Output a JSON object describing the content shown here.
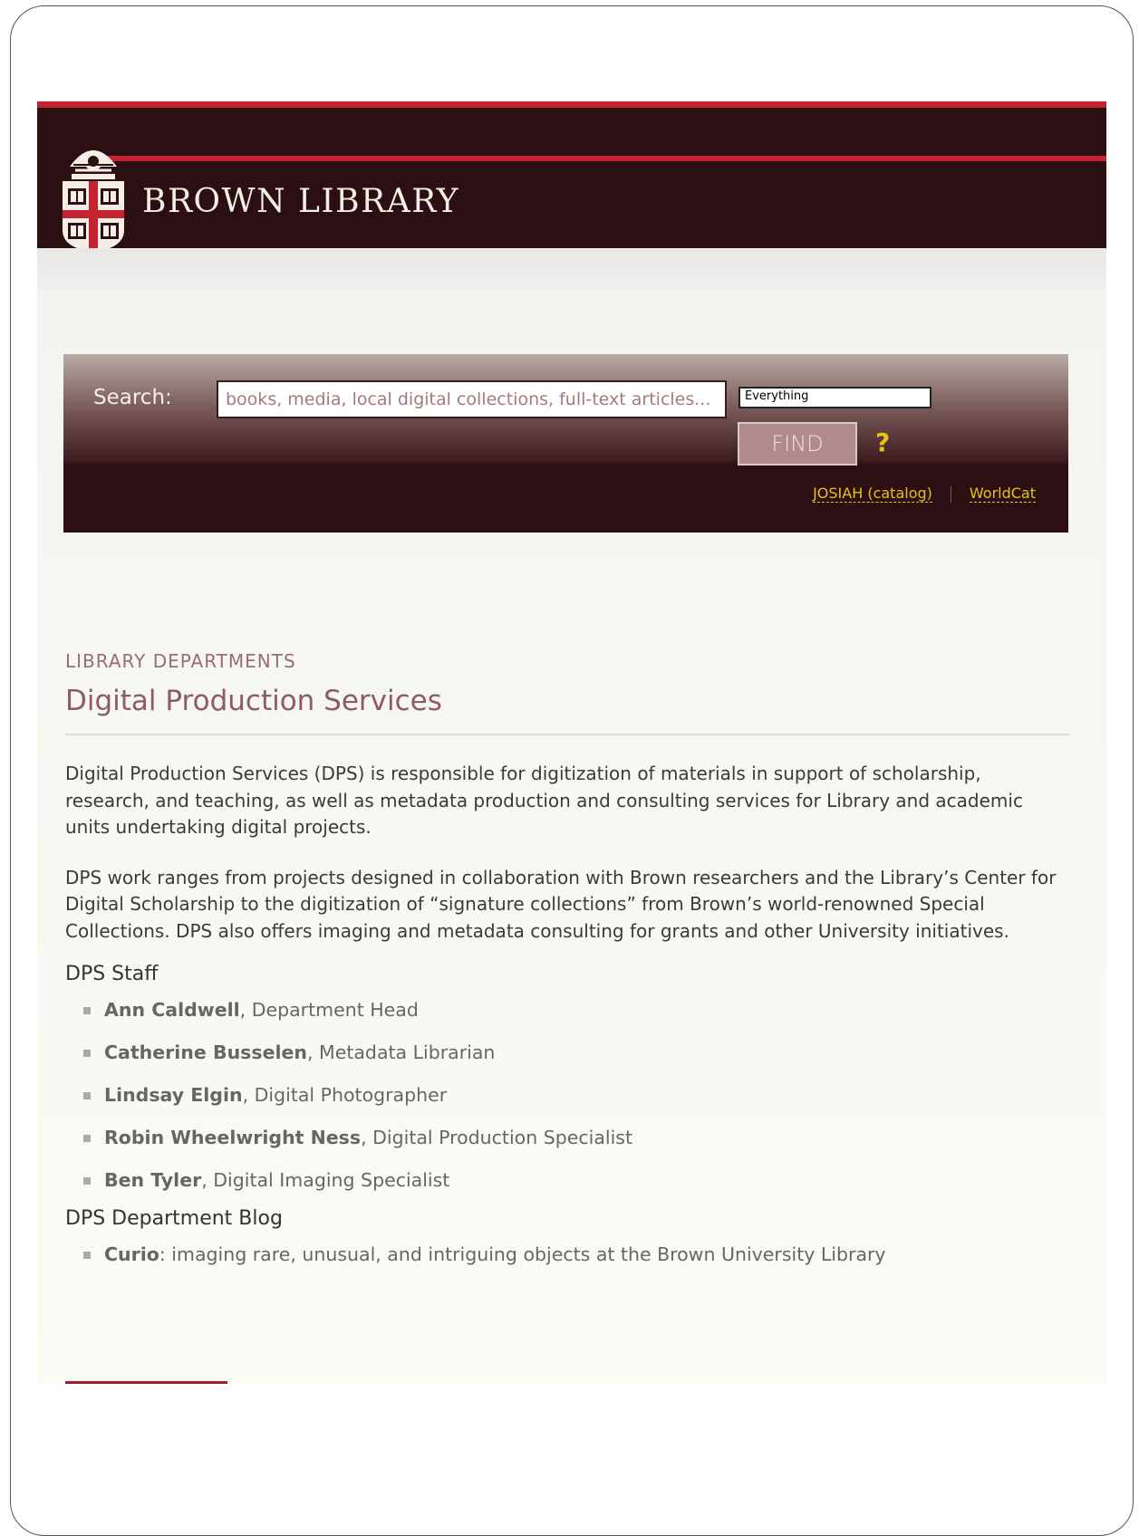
{
  "brand": {
    "name": "BROWN LIBRARY"
  },
  "search": {
    "label": "Search:",
    "placeholder": "books, media, local digital collections, full-text articles...",
    "scope_selected": "Everything",
    "find_label": "FIND",
    "help_label": "?"
  },
  "quicklinks": [
    {
      "label": "JOSIAH (catalog)"
    },
    {
      "label": "WorldCat"
    }
  ],
  "content": {
    "kicker": "LIBRARY DEPARTMENTS",
    "title": "Digital Production Services",
    "paragraphs": [
      "Digital Production Services (DPS) is responsible for digitization of materials in support of scholarship, research, and teaching, as well as metadata production and consulting services for Library and academic units undertaking digital projects.",
      "DPS work ranges from projects designed in collaboration with Brown researchers and the Library’s Center for Digital Scholarship to the digitization of “signature collections” from Brown’s world-renowned Special Collections. DPS also offers imaging and metadata consulting for grants and other University initiatives."
    ],
    "staff_heading": "DPS Staff",
    "staff": [
      {
        "name": "Ann Caldwell",
        "role": ", Department Head"
      },
      {
        "name": "Catherine Busselen",
        "role": ", Metadata Librarian"
      },
      {
        "name": "Lindsay Elgin",
        "role": ", Digital Photographer"
      },
      {
        "name": "Robin Wheelwright Ness",
        "role": ", Digital Production Specialist"
      },
      {
        "name": "Ben Tyler",
        "role": ", Digital Imaging Specialist"
      }
    ],
    "blog_heading": "DPS Department Blog",
    "blog": [
      {
        "name": "Curio",
        "desc": ": imaging rare, unusual, and intriguing objects at the Brown University Library"
      }
    ]
  },
  "colors": {
    "header_bg": "#2c0f12",
    "accent_red": "#c4232f",
    "link_yellow": "#e6c21a",
    "title_mauve": "#8d5c63"
  }
}
